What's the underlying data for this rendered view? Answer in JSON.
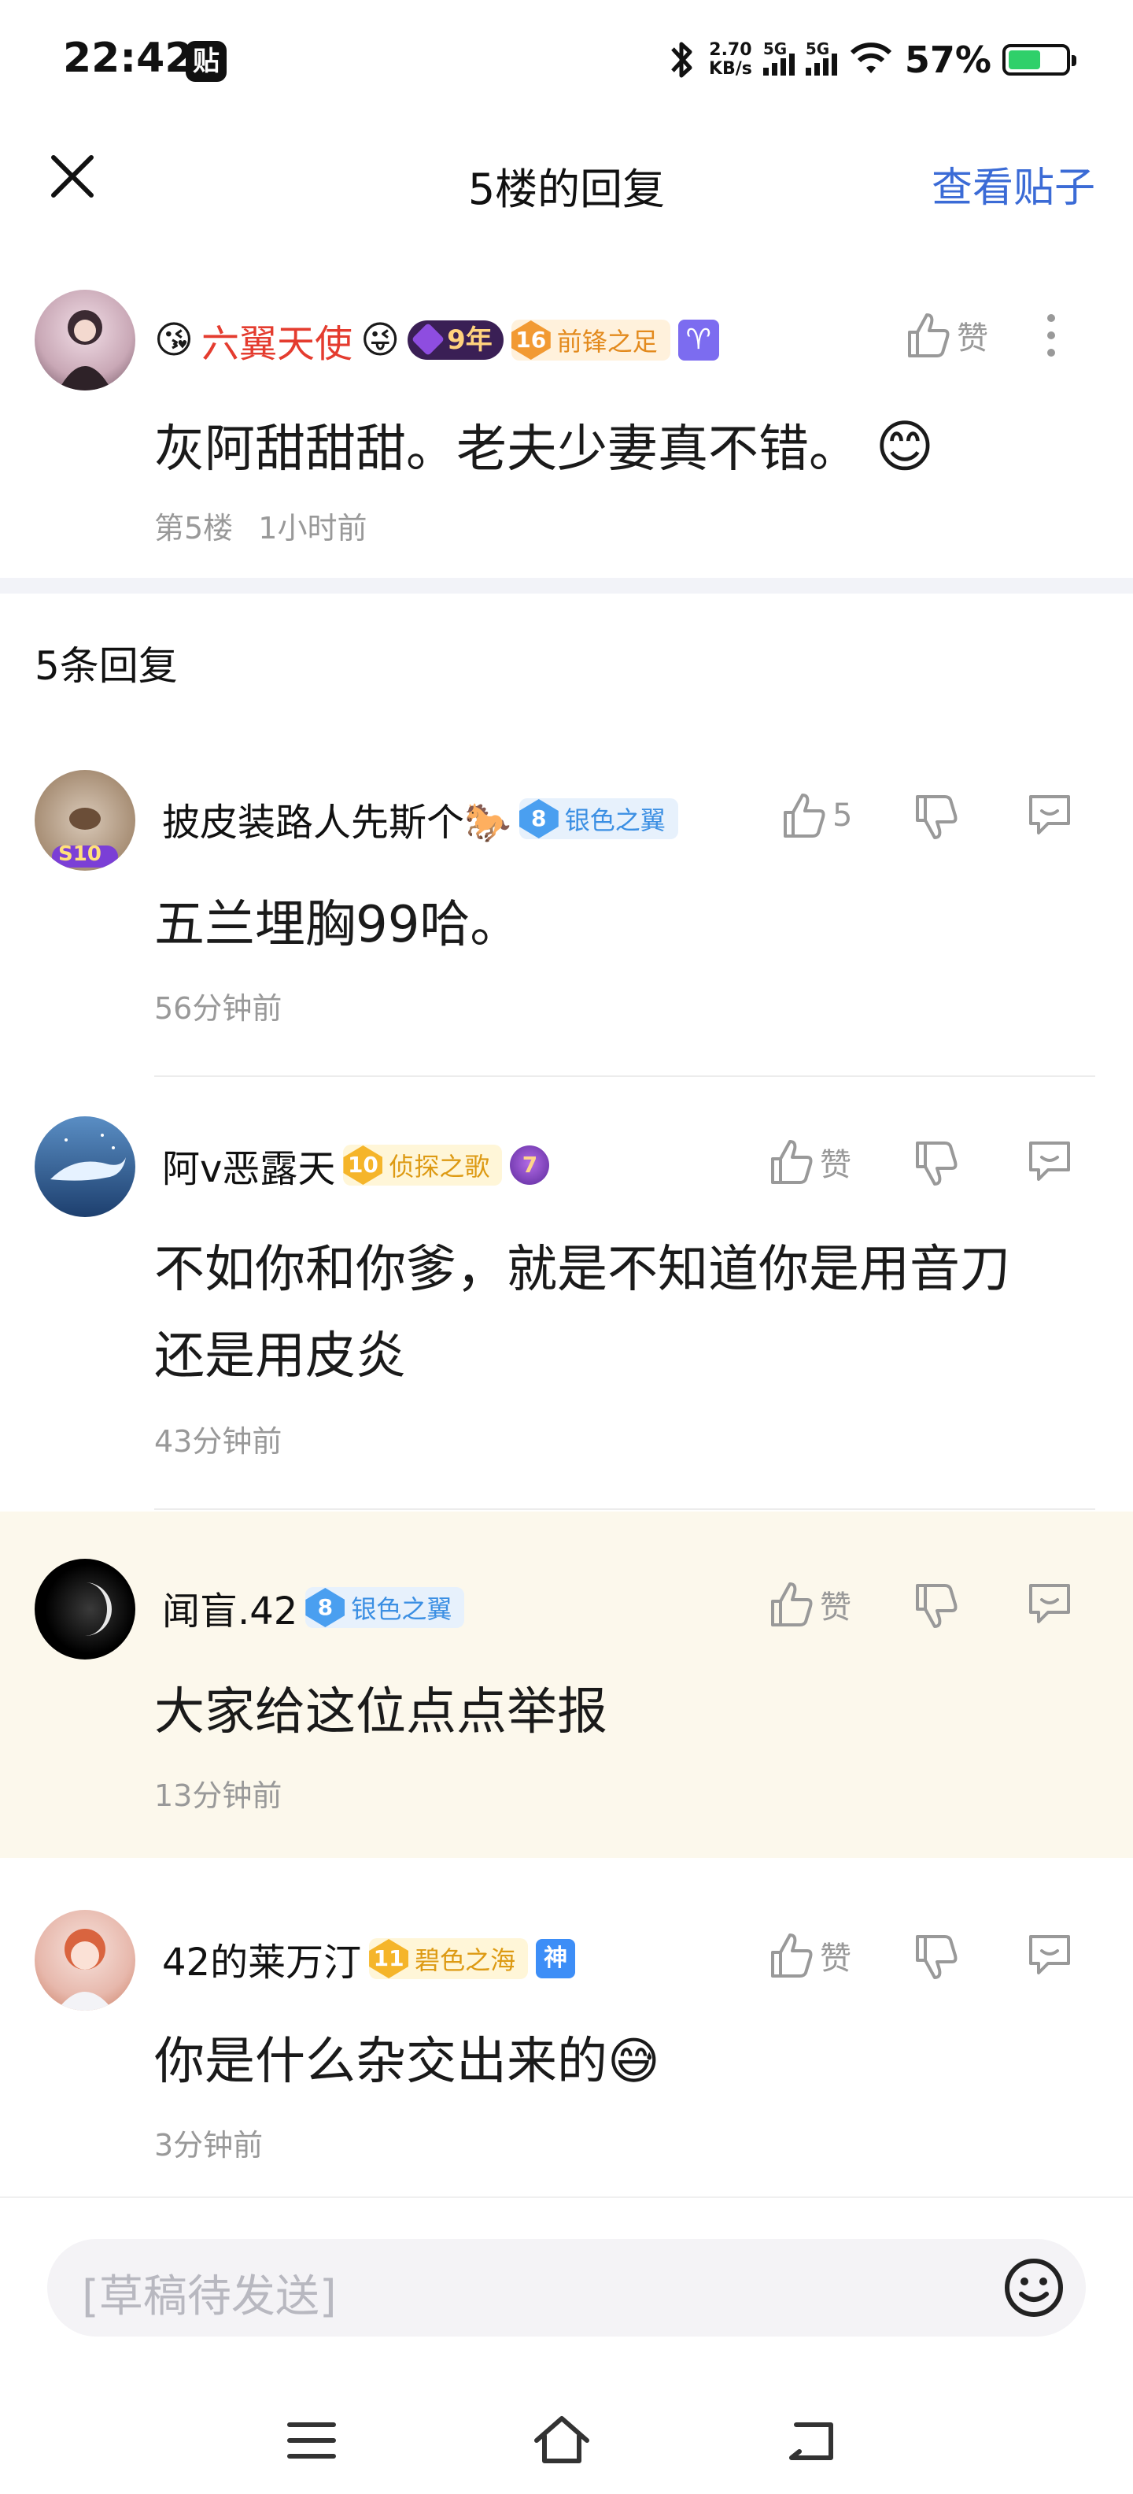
{
  "status_bar": {
    "time": "22:42",
    "notification_badge": "贴",
    "net_speed_value": "2.70",
    "net_speed_unit": "KB/s",
    "sim1_label": "5G",
    "sim2_label": "5G",
    "battery_percent": "57%",
    "battery_level": 0.57
  },
  "nav": {
    "title": "5楼的回复",
    "view_post": "查看贴子"
  },
  "floor": {
    "user": {
      "emoji_left": "😘",
      "name": "六翼天使",
      "emoji_right": "😜",
      "year_badge": "9年",
      "level": "16",
      "level_title": "前锋之足",
      "zodiac": "♈"
    },
    "like_label": "赞",
    "content": "灰阿甜甜甜。老夫少妻真不错。",
    "content_emoji": "😊",
    "floor_no": "第5楼",
    "time": "1小时前"
  },
  "replies_header": "5条回复",
  "replies": [
    {
      "name": "披皮装路人先斯个🐎",
      "level": "8",
      "level_title": "银色之翼",
      "level_color": "blue",
      "like_label": "5",
      "content": "五兰埋胸99哈。",
      "time": "56分钟前",
      "avatar_tag": "S10"
    },
    {
      "name": "阿v恶露天",
      "level": "10",
      "level_title": "侦探之歌",
      "level_color": "gold",
      "extra_badge": "7",
      "like_label": "赞",
      "content_line1": "不如你和你爹，就是不知道你是用音刀",
      "content_line2": "还是用皮炎",
      "time": "43分钟前"
    },
    {
      "name": "闻盲.42",
      "level": "8",
      "level_title": "银色之翼",
      "level_color": "blue",
      "like_label": "赞",
      "content": "大家给这位点点举报",
      "time": "13分钟前"
    },
    {
      "name": "42的莱万汀",
      "level": "11",
      "level_title": "碧色之海",
      "level_color": "gold",
      "extra_badge": "神",
      "like_label": "赞",
      "content": "你是什么杂交出来的😅",
      "time": "3分钟前"
    }
  ],
  "input": {
    "placeholder": "[草稿待发送]"
  },
  "icons": {
    "close": "close-icon",
    "like": "thumb-up-icon",
    "dislike": "thumb-down-icon",
    "reply": "comment-icon",
    "more": "more-vertical-icon",
    "emoji": "smile-icon",
    "menu": "menu-icon",
    "home": "home-icon",
    "back": "back-icon"
  },
  "colors": {
    "accent": "#3b6bd6",
    "highlight_row": "#fcf8ec",
    "red_name": "#e43c2f"
  }
}
